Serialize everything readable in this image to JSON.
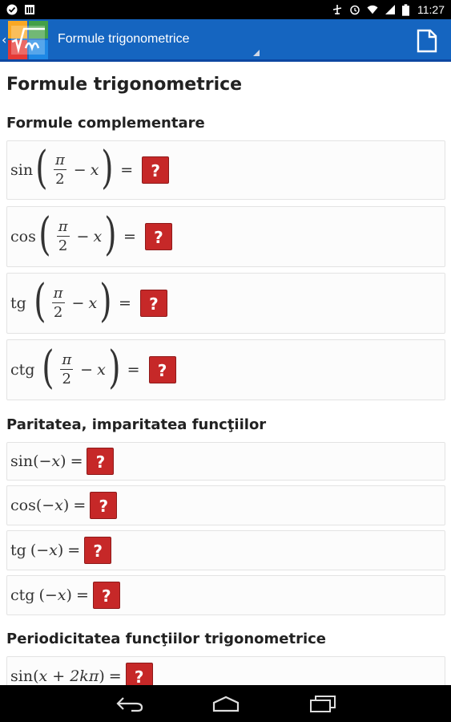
{
  "status_bar": {
    "time": "11:27"
  },
  "action_bar": {
    "title": "Formule trigonometrice",
    "back_glyph": "‹"
  },
  "page": {
    "title": "Formule trigonometrice"
  },
  "sections": [
    {
      "title": "Formule complementare",
      "formulas": [
        {
          "fn": "sin",
          "frac_num": "π",
          "frac_den": "2",
          "minus": "−",
          "var": "x",
          "eq": "=",
          "answer": "?"
        },
        {
          "fn": "cos",
          "frac_num": "π",
          "frac_den": "2",
          "minus": "−",
          "var": "x",
          "eq": "=",
          "answer": "?"
        },
        {
          "fn": "tg",
          "frac_num": "π",
          "frac_den": "2",
          "minus": "−",
          "var": "x",
          "eq": "=",
          "answer": "?"
        },
        {
          "fn": "ctg",
          "frac_num": "π",
          "frac_den": "2",
          "minus": "−",
          "var": "x",
          "eq": "=",
          "answer": "?"
        }
      ]
    },
    {
      "title": "Paritatea, imparitatea funcţiilor",
      "formulas": [
        {
          "fn": "sin",
          "arg": "−x",
          "eq": "=",
          "answer": "?"
        },
        {
          "fn": "cos",
          "arg": "−x",
          "eq": "=",
          "answer": "?"
        },
        {
          "fn": "tg",
          "arg": "−x",
          "eq": "=",
          "answer": "?"
        },
        {
          "fn": "ctg",
          "arg": "−x",
          "eq": "=",
          "answer": "?"
        }
      ]
    },
    {
      "title": "Periodicitatea funcţiilor trigonometrice",
      "formulas": [
        {
          "fn": "sin",
          "arg": "x + 2kπ",
          "eq": "=",
          "answer": "?"
        }
      ]
    }
  ]
}
